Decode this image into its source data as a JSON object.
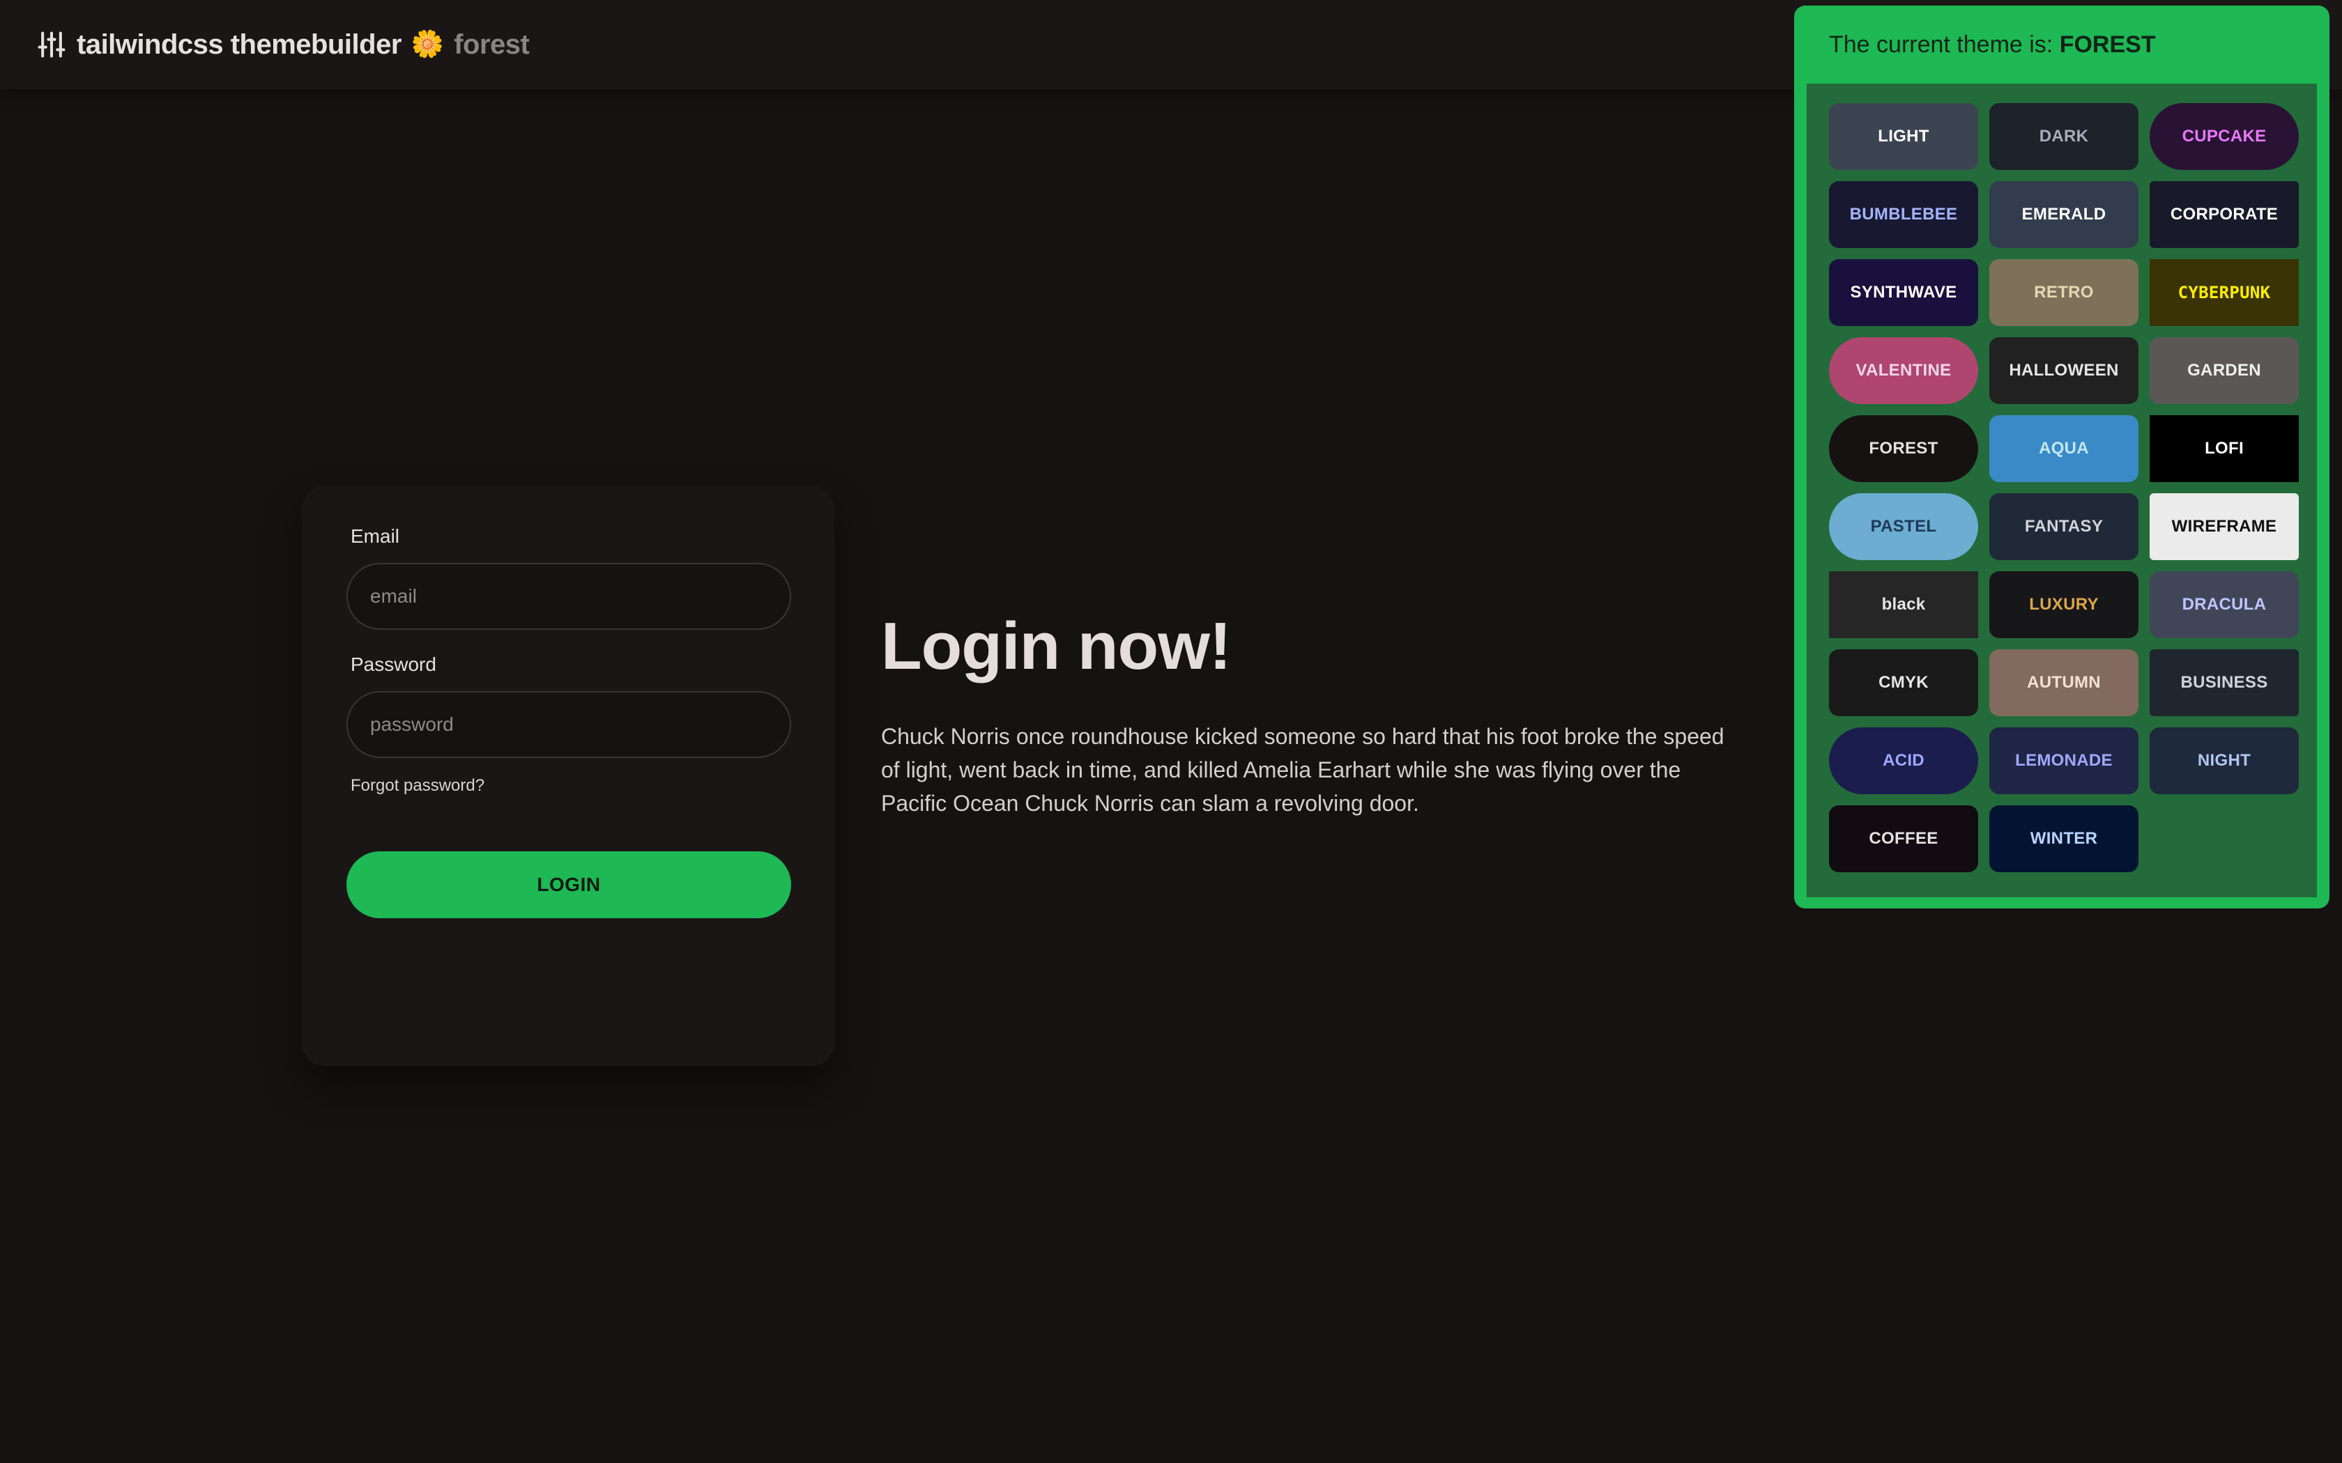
{
  "header": {
    "brand": "tailwindcss themebuilder",
    "flower": "🌼",
    "current_theme": "forest"
  },
  "login": {
    "email_label": "Email",
    "email_placeholder": "email",
    "password_label": "Password",
    "password_placeholder": "password",
    "forgot": "Forgot password?",
    "button": "LOGIN"
  },
  "hero": {
    "title": "Login now!",
    "body": "Chuck Norris once roundhouse kicked someone so hard that his foot broke the speed of light, went back in time, and killed Amelia Earhart while she was flying over the Pacific Ocean Chuck Norris can slam a revolving door."
  },
  "theme_panel": {
    "prefix": "The current theme is: ",
    "current": "FOREST",
    "accent": "#1eb854",
    "themes": [
      {
        "label": "LIGHT",
        "bg": "#3d4451",
        "fg": "#ffffff",
        "shape": "r-md"
      },
      {
        "label": "DARK",
        "bg": "#1d232a",
        "fg": "#a6adbb",
        "shape": "r-md"
      },
      {
        "label": "CUPCAKE",
        "bg": "#291334",
        "fg": "#e879f9",
        "shape": "r-pill"
      },
      {
        "label": "BUMBLEBEE",
        "bg": "#181830",
        "fg": "#a5b4fc",
        "shape": "r-md"
      },
      {
        "label": "EMERALD",
        "bg": "#333c4d",
        "fg": "#ffffff",
        "shape": "r-md"
      },
      {
        "label": "CORPORATE",
        "bg": "#181a2a",
        "fg": "#ffffff",
        "shape": "r-sm"
      },
      {
        "label": "SYNTHWAVE",
        "bg": "#1a103d",
        "fg": "#ffffff",
        "shape": "r-md"
      },
      {
        "label": "RETRO",
        "bg": "#7d7259",
        "fg": "#e4d8b4",
        "shape": "r-md"
      },
      {
        "label": "CYBERPUNK",
        "bg": "#3a3305",
        "fg": "#ffee00",
        "shape": "r-sq"
      },
      {
        "label": "VALENTINE",
        "bg": "#af4670",
        "fg": "#f0d6e8",
        "shape": "r-pill"
      },
      {
        "label": "HALLOWEEN",
        "bg": "#212121",
        "fg": "#e6e6e6",
        "shape": "r-md"
      },
      {
        "label": "GARDEN",
        "bg": "#5c5757",
        "fg": "#f0f0f0",
        "shape": "r-md"
      },
      {
        "label": "FOREST",
        "bg": "#171212",
        "fg": "#e6e1e1",
        "shape": "r-pill"
      },
      {
        "label": "AQUA",
        "bg": "#3a8ac8",
        "fg": "#c3e7f5",
        "shape": "r-md"
      },
      {
        "label": "LOFI",
        "bg": "#000000",
        "fg": "#ffffff",
        "shape": "r-sq"
      },
      {
        "label": "PASTEL",
        "bg": "#6cadd1",
        "fg": "#1e3a5a",
        "shape": "r-pill"
      },
      {
        "label": "FANTASY",
        "bg": "#1f2937",
        "fg": "#d1d5db",
        "shape": "r-md"
      },
      {
        "label": "WIREFRAME",
        "bg": "#ebebeb",
        "fg": "#111111",
        "shape": "r-sm"
      },
      {
        "label": "black",
        "bg": "#262626",
        "fg": "#e6e6e6",
        "shape": "r-sq"
      },
      {
        "label": "LUXURY",
        "bg": "#171618",
        "fg": "#dca54c",
        "shape": "r-md"
      },
      {
        "label": "DRACULA",
        "bg": "#414558",
        "fg": "#bfc5ff",
        "shape": "r-md"
      },
      {
        "label": "CMYK",
        "bg": "#1a1a1a",
        "fg": "#e6e6e6",
        "shape": "r-md"
      },
      {
        "label": "AUTUMN",
        "bg": "#826a5c",
        "fg": "#f4e1d2",
        "shape": "r-md"
      },
      {
        "label": "BUSINESS",
        "bg": "#202630",
        "fg": "#d0d4db",
        "shape": "r-sm"
      },
      {
        "label": "ACID",
        "bg": "#1b1d4d",
        "fg": "#9fa8ff",
        "shape": "r-pill"
      },
      {
        "label": "LEMONADE",
        "bg": "#1f2544",
        "fg": "#a0a8ff",
        "shape": "r-md"
      },
      {
        "label": "NIGHT",
        "bg": "#1e293b",
        "fg": "#b3c5ef",
        "shape": "r-md"
      },
      {
        "label": "COFFEE",
        "bg": "#120c12",
        "fg": "#e6e1e1",
        "shape": "r-md"
      },
      {
        "label": "WINTER",
        "bg": "#021431",
        "fg": "#bcd3ff",
        "shape": "r-md"
      }
    ]
  }
}
